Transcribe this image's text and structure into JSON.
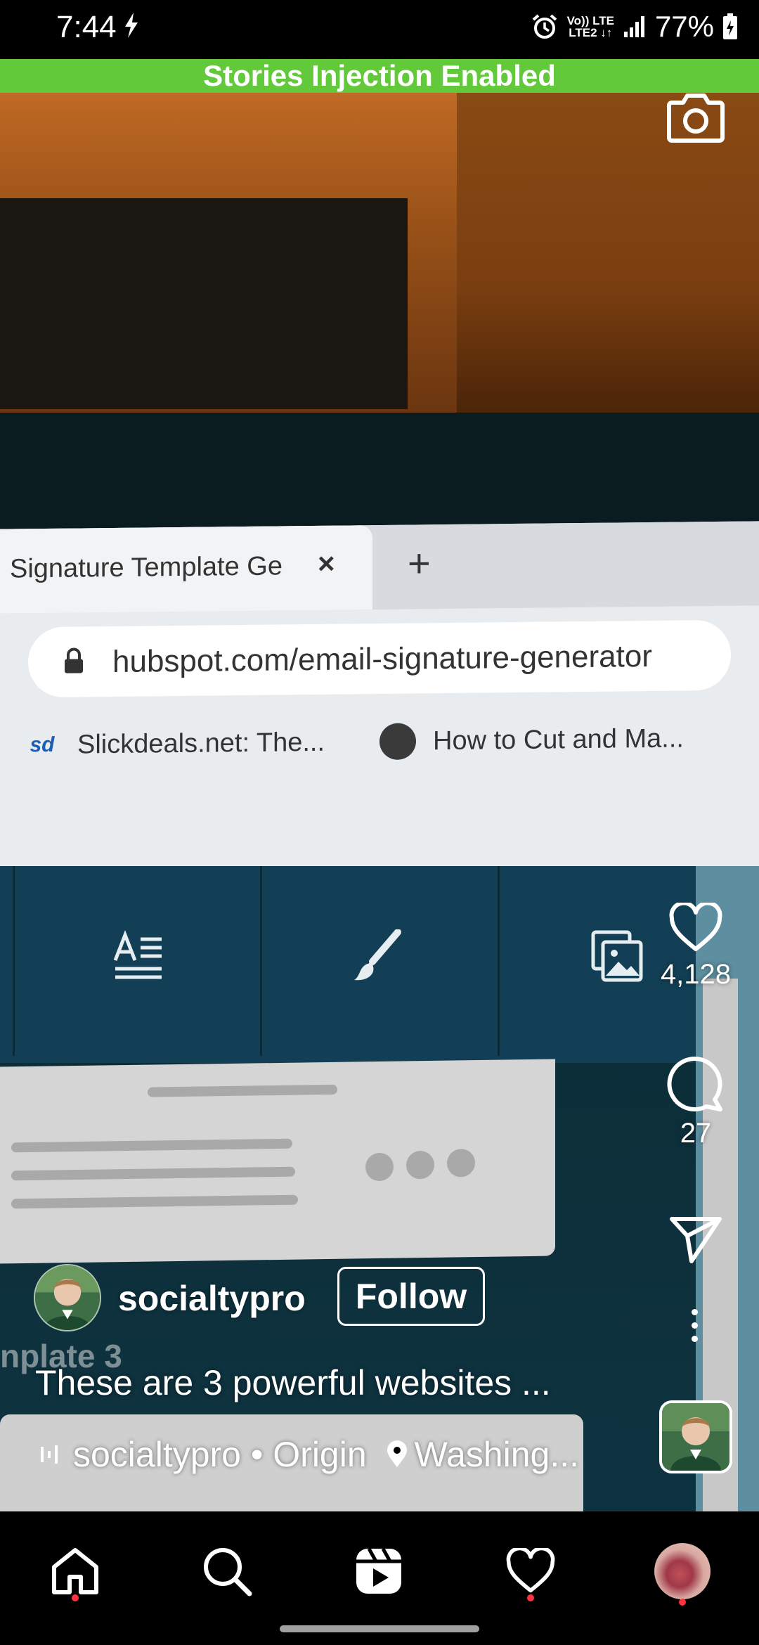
{
  "status_bar": {
    "time": "7:44",
    "network_top": "Vo)) LTE",
    "network_bottom": "LTE2 ↓↑",
    "battery": "77%"
  },
  "banner": {
    "text": "Stories Injection Enabled"
  },
  "video_content": {
    "tab_title": "Signature Template Ge",
    "tab_close": "×",
    "new_tab": "+",
    "address": "hubspot.com/email-signature-generator",
    "bookmark_1_icon": "sd",
    "bookmark_1": "Slickdeals.net: The...",
    "bookmark_2": "How to Cut and Ma...",
    "ghost_text": "nplate 3"
  },
  "actions": {
    "like_count": "4,128",
    "comment_count": "27"
  },
  "post": {
    "username": "socialtypro",
    "follow_label": "Follow",
    "caption": "These are 3 powerful websites ...",
    "audio_label": "socialtypro • Origin",
    "location_label": "Washing..."
  },
  "colors": {
    "banner": "#61c93a",
    "notification_dot": "#ff3040",
    "nav_background": "#000000"
  },
  "icons": {
    "camera": "camera-icon",
    "like": "heart-icon",
    "comment": "comment-icon",
    "share": "send-icon",
    "more": "more-vertical-icon",
    "nav": [
      "home-icon",
      "search-icon",
      "reels-icon",
      "heart-icon",
      "profile-avatar"
    ]
  }
}
